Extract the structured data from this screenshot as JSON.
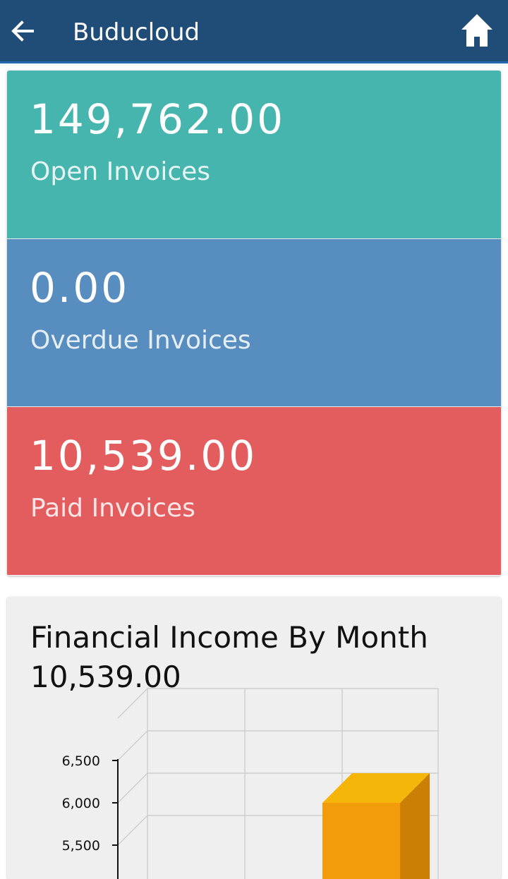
{
  "appbar": {
    "title": "Buducloud",
    "back_icon": "arrow-left-icon",
    "home_icon": "home-icon",
    "color": "#1f4d78"
  },
  "summary": [
    {
      "value": "149,762.00",
      "label": "Open Invoices",
      "color": "#45b5ad"
    },
    {
      "value": "0.00",
      "label": "Overdue Invoices",
      "color": "#578dbf"
    },
    {
      "value": "10,539.00",
      "label": "Paid Invoices",
      "color": "#e35c5e"
    }
  ],
  "chart": {
    "title": "Financial Income By Month",
    "total": "10,539.00"
  },
  "chart_data": {
    "type": "bar",
    "title": "Financial Income By Month",
    "xlabel": "",
    "ylabel": "",
    "y_ticks": [
      "5,500",
      "6,000",
      "6,500"
    ],
    "visible_ylim": [
      5500,
      6500
    ],
    "series": [
      {
        "values": [
          6000
        ],
        "color": "#f39c0b",
        "bar_note": "3D bar in third category column, top at 6,000"
      }
    ],
    "grid": true
  }
}
